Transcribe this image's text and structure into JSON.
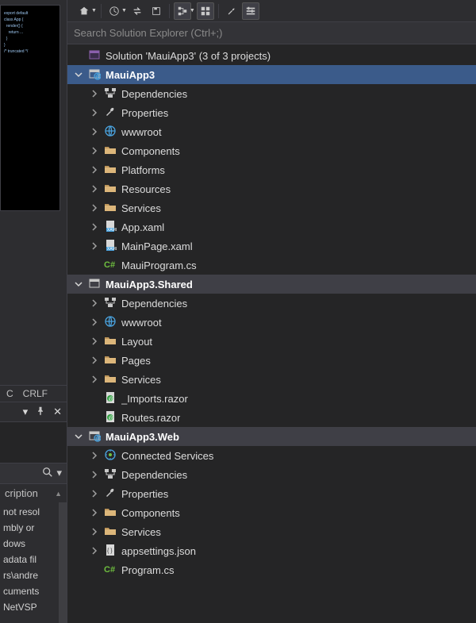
{
  "left": {
    "status_c": "C",
    "status_crlf": "CRLF",
    "search_icon_title": "search",
    "desc_header": "cription",
    "msg_lines": [
      "not resol",
      "mbly or",
      "dows",
      "adata fil",
      "rs\\andre",
      "cuments",
      "NetVSP"
    ]
  },
  "toolbar": {
    "items": [
      "home-icon",
      "history-icon",
      "sync-icon",
      "save-all-icon",
      "tree-view-icon",
      "collapse-icon",
      "wrench-icon",
      "properties-icon"
    ]
  },
  "search": {
    "placeholder": "Search Solution Explorer (Ctrl+;)"
  },
  "solution": {
    "label": "Solution 'MauiApp3' (3 of 3 projects)"
  },
  "projects": [
    {
      "name": "MauiApp3",
      "bold": true,
      "primary": true,
      "children": [
        {
          "icon": "deps",
          "label": "Dependencies",
          "twisty": "closed"
        },
        {
          "icon": "wrench",
          "label": "Properties",
          "twisty": "closed"
        },
        {
          "icon": "globe",
          "label": "wwwroot",
          "twisty": "closed"
        },
        {
          "icon": "folder",
          "label": "Components",
          "twisty": "closed"
        },
        {
          "icon": "folder",
          "label": "Platforms",
          "twisty": "closed"
        },
        {
          "icon": "folder",
          "label": "Resources",
          "twisty": "closed"
        },
        {
          "icon": "folder",
          "label": "Services",
          "twisty": "closed"
        },
        {
          "icon": "xaml",
          "label": "App.xaml",
          "twisty": "closed"
        },
        {
          "icon": "xaml",
          "label": "MainPage.xaml",
          "twisty": "closed"
        },
        {
          "icon": "cs",
          "label": "MauiProgram.cs",
          "twisty": "none"
        }
      ]
    },
    {
      "name": "MauiApp3.Shared",
      "bold": false,
      "primary": false,
      "children": [
        {
          "icon": "deps",
          "label": "Dependencies",
          "twisty": "closed"
        },
        {
          "icon": "globe",
          "label": "wwwroot",
          "twisty": "closed"
        },
        {
          "icon": "folder",
          "label": "Layout",
          "twisty": "closed"
        },
        {
          "icon": "folder",
          "label": "Pages",
          "twisty": "closed"
        },
        {
          "icon": "folder",
          "label": "Services",
          "twisty": "closed"
        },
        {
          "icon": "razor",
          "label": "_Imports.razor",
          "twisty": "none"
        },
        {
          "icon": "razor",
          "label": "Routes.razor",
          "twisty": "none"
        }
      ]
    },
    {
      "name": "MauiApp3.Web",
      "bold": false,
      "primary": false,
      "children": [
        {
          "icon": "connected",
          "label": "Connected Services",
          "twisty": "closed"
        },
        {
          "icon": "deps",
          "label": "Dependencies",
          "twisty": "closed"
        },
        {
          "icon": "wrench",
          "label": "Properties",
          "twisty": "closed"
        },
        {
          "icon": "folder",
          "label": "Components",
          "twisty": "closed"
        },
        {
          "icon": "folder",
          "label": "Services",
          "twisty": "closed"
        },
        {
          "icon": "json",
          "label": "appsettings.json",
          "twisty": "closed"
        },
        {
          "icon": "cs",
          "label": "Program.cs",
          "twisty": "none"
        }
      ]
    }
  ]
}
